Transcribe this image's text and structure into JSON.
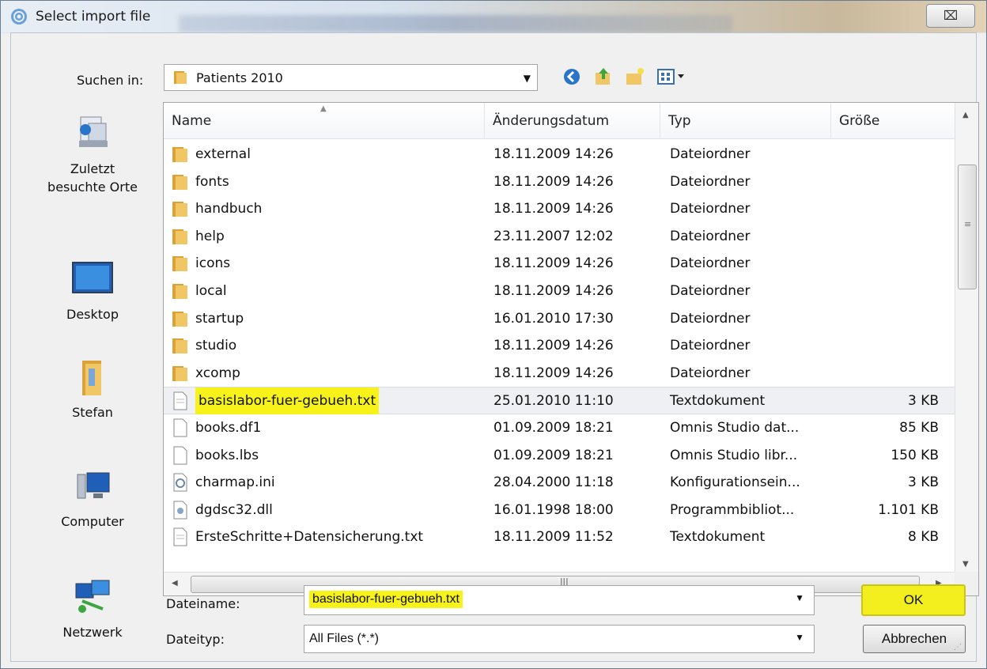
{
  "window": {
    "title": "Select import file",
    "close_symbol": "⌧"
  },
  "lookin": {
    "label": "Suchen in:",
    "value": "Patients 2010"
  },
  "toolbar": {
    "icons": [
      "back-icon",
      "up-folder-icon",
      "new-folder-icon",
      "view-menu-icon"
    ]
  },
  "places": [
    {
      "label": "Zuletzt\nbesuchte Orte",
      "icon": "recent-places-icon"
    },
    {
      "label": "Desktop",
      "icon": "desktop-icon"
    },
    {
      "label": "Stefan",
      "icon": "user-folder-icon"
    },
    {
      "label": "Computer",
      "icon": "computer-icon"
    },
    {
      "label": "Netzwerk",
      "icon": "network-icon"
    }
  ],
  "columns": {
    "name": "Name",
    "date": "Änderungsdatum",
    "type": "Typ",
    "size": "Größe"
  },
  "files": [
    {
      "name": "external",
      "date": "18.11.2009 14:26",
      "type": "Dateiordner",
      "size": "",
      "icon": "folder"
    },
    {
      "name": "fonts",
      "date": "18.11.2009 14:26",
      "type": "Dateiordner",
      "size": "",
      "icon": "folder"
    },
    {
      "name": "handbuch",
      "date": "18.11.2009 14:26",
      "type": "Dateiordner",
      "size": "",
      "icon": "folder"
    },
    {
      "name": "help",
      "date": "23.11.2007 12:02",
      "type": "Dateiordner",
      "size": "",
      "icon": "folder"
    },
    {
      "name": "icons",
      "date": "18.11.2009 14:26",
      "type": "Dateiordner",
      "size": "",
      "icon": "folder"
    },
    {
      "name": "local",
      "date": "18.11.2009 14:26",
      "type": "Dateiordner",
      "size": "",
      "icon": "folder"
    },
    {
      "name": "startup",
      "date": "16.01.2010 17:30",
      "type": "Dateiordner",
      "size": "",
      "icon": "folder"
    },
    {
      "name": "studio",
      "date": "18.11.2009 14:26",
      "type": "Dateiordner",
      "size": "",
      "icon": "folder"
    },
    {
      "name": "xcomp",
      "date": "18.11.2009 14:26",
      "type": "Dateiordner",
      "size": "",
      "icon": "folder"
    },
    {
      "name": "basislabor-fuer-gebueh.txt",
      "date": "25.01.2010 11:10",
      "type": "Textdokument",
      "size": "3 KB",
      "icon": "text"
    },
    {
      "name": "books.df1",
      "date": "01.09.2009 18:21",
      "type": "Omnis Studio dat...",
      "size": "85 KB",
      "icon": "file"
    },
    {
      "name": "books.lbs",
      "date": "01.09.2009 18:21",
      "type": "Omnis Studio libr...",
      "size": "150 KB",
      "icon": "file"
    },
    {
      "name": "charmap.ini",
      "date": "28.04.2000 11:18",
      "type": "Konfigurationsein...",
      "size": "3 KB",
      "icon": "ini"
    },
    {
      "name": "dgdsc32.dll",
      "date": "16.01.1998 18:00",
      "type": "Programmbibliot...",
      "size": "1.101 KB",
      "icon": "dll"
    },
    {
      "name": "ErsteSchritte+Datensicherung.txt",
      "date": "18.11.2009 11:52",
      "type": "Textdokument",
      "size": "8 KB",
      "icon": "text"
    }
  ],
  "selected_index": 9,
  "scroll_grip": "≡",
  "hscroll_grip": "III",
  "filename": {
    "label": "Dateiname:",
    "value": "basislabor-fuer-gebueh.txt"
  },
  "filetype": {
    "label": "Dateityp:",
    "value": "All Files (*.*)"
  },
  "buttons": {
    "ok": "OK",
    "cancel": "Abbrechen"
  },
  "colors": {
    "highlight": "#f6f21a",
    "folder": "#e8b64a"
  }
}
